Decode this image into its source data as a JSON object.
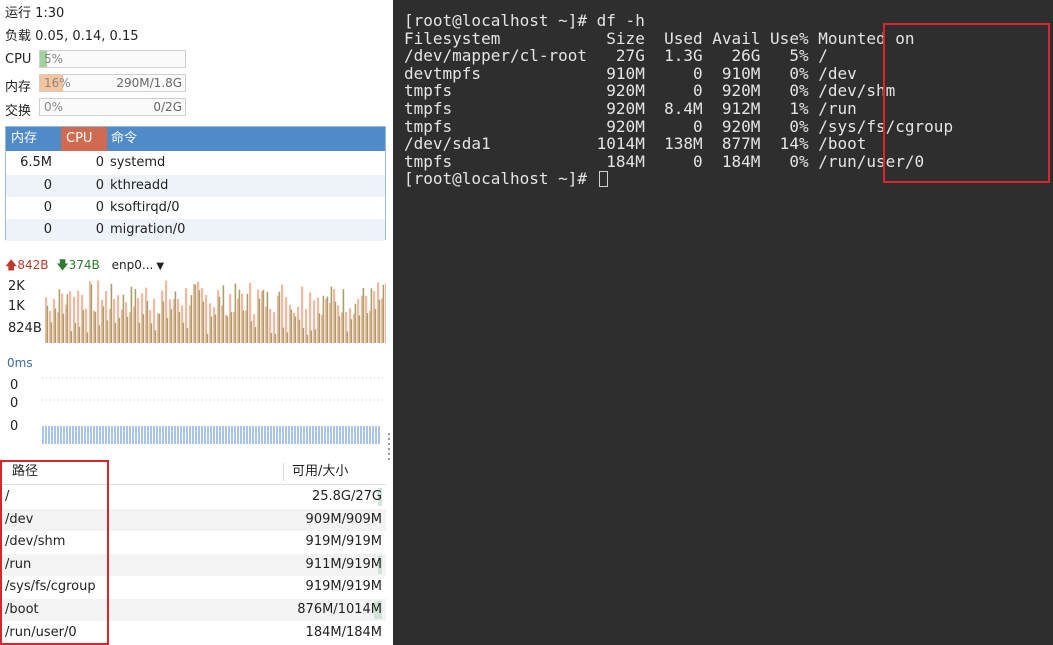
{
  "system": {
    "uptime_label": "运行 1:30",
    "load_label": "负载 0.05, 0.14, 0.15",
    "cpu": {
      "label": "CPU",
      "percent_text": "5%",
      "fill": 0.05
    },
    "mem": {
      "label": "内存",
      "percent_text": "16%",
      "fill": 0.16,
      "detail": "290M/1.8G"
    },
    "swap": {
      "label": "交换",
      "percent_text": "0%",
      "fill": 0.0,
      "detail": "0/2G"
    }
  },
  "process_table": {
    "headers": {
      "mem": "内存",
      "cpu": "CPU",
      "cmd": "命令"
    },
    "rows": [
      {
        "mem": "6.5M",
        "cpu": "0",
        "cmd": "systemd"
      },
      {
        "mem": "0",
        "cpu": "0",
        "cmd": "kthreadd"
      },
      {
        "mem": "0",
        "cpu": "0",
        "cmd": "ksoftirqd/0"
      },
      {
        "mem": "0",
        "cpu": "0",
        "cmd": "migration/0"
      }
    ]
  },
  "network": {
    "upload": "842B",
    "download": "374B",
    "interface": "enp0...",
    "y_labels": [
      "2K",
      "1K",
      "824B"
    ]
  },
  "latency": {
    "title": "0ms",
    "y_labels": [
      "0",
      "0",
      "0"
    ]
  },
  "disks": {
    "headers": {
      "path": "路径",
      "size": "可用/大小"
    },
    "rows": [
      {
        "path": "/",
        "size": "25.8G/27G",
        "used": 0.05
      },
      {
        "path": "/dev",
        "size": "909M/909M",
        "used": 0.0
      },
      {
        "path": "/dev/shm",
        "size": "919M/919M",
        "used": 0.0
      },
      {
        "path": "/run",
        "size": "911M/919M",
        "used": 0.01
      },
      {
        "path": "/sys/fs/cgroup",
        "size": "919M/919M",
        "used": 0.0
      },
      {
        "path": "/boot",
        "size": "876M/1014M",
        "used": 0.14
      },
      {
        "path": "/run/user/0",
        "size": "184M/184M",
        "used": 0.0
      }
    ]
  },
  "terminal": {
    "prompt": "[root@localhost ~]# ",
    "command": "df -h",
    "header": {
      "filesystem": "Filesystem",
      "size": "Size",
      "used": "Used",
      "avail": "Avail",
      "use_pct": "Use%",
      "mounted": "Mounted on"
    },
    "rows": [
      {
        "fs": "/dev/mapper/cl-root",
        "size": "27G",
        "used": "1.3G",
        "avail": "26G",
        "pct": "5%",
        "mount": "/"
      },
      {
        "fs": "devtmpfs",
        "size": "910M",
        "used": "0",
        "avail": "910M",
        "pct": "0%",
        "mount": "/dev"
      },
      {
        "fs": "tmpfs",
        "size": "920M",
        "used": "0",
        "avail": "920M",
        "pct": "0%",
        "mount": "/dev/shm"
      },
      {
        "fs": "tmpfs",
        "size": "920M",
        "used": "8.4M",
        "avail": "912M",
        "pct": "1%",
        "mount": "/run"
      },
      {
        "fs": "tmpfs",
        "size": "920M",
        "used": "0",
        "avail": "920M",
        "pct": "0%",
        "mount": "/sys/fs/cgroup"
      },
      {
        "fs": "/dev/sda1",
        "size": "1014M",
        "used": "138M",
        "avail": "877M",
        "pct": "14%",
        "mount": "/boot"
      },
      {
        "fs": "tmpfs",
        "size": "184M",
        "used": "0",
        "avail": "184M",
        "pct": "0%",
        "mount": "/run/user/0"
      }
    ]
  },
  "colors": {
    "highlight_box": "#d9262c",
    "header_blue": "#4f8bc9",
    "cpu_header": "#d06a50",
    "upload_arrow": "#c0392b",
    "download_arrow": "#2e7d32",
    "cpu_fill": "#9fd39b",
    "mem_fill": "#f5c49a",
    "net_up_bar": "#f2b9a0",
    "net_down_bar": "#a7a06a",
    "latency_bar": "#a9c4ee",
    "terminal_bg": "#2e2e2e",
    "terminal_fg": "#e4e4e4"
  }
}
